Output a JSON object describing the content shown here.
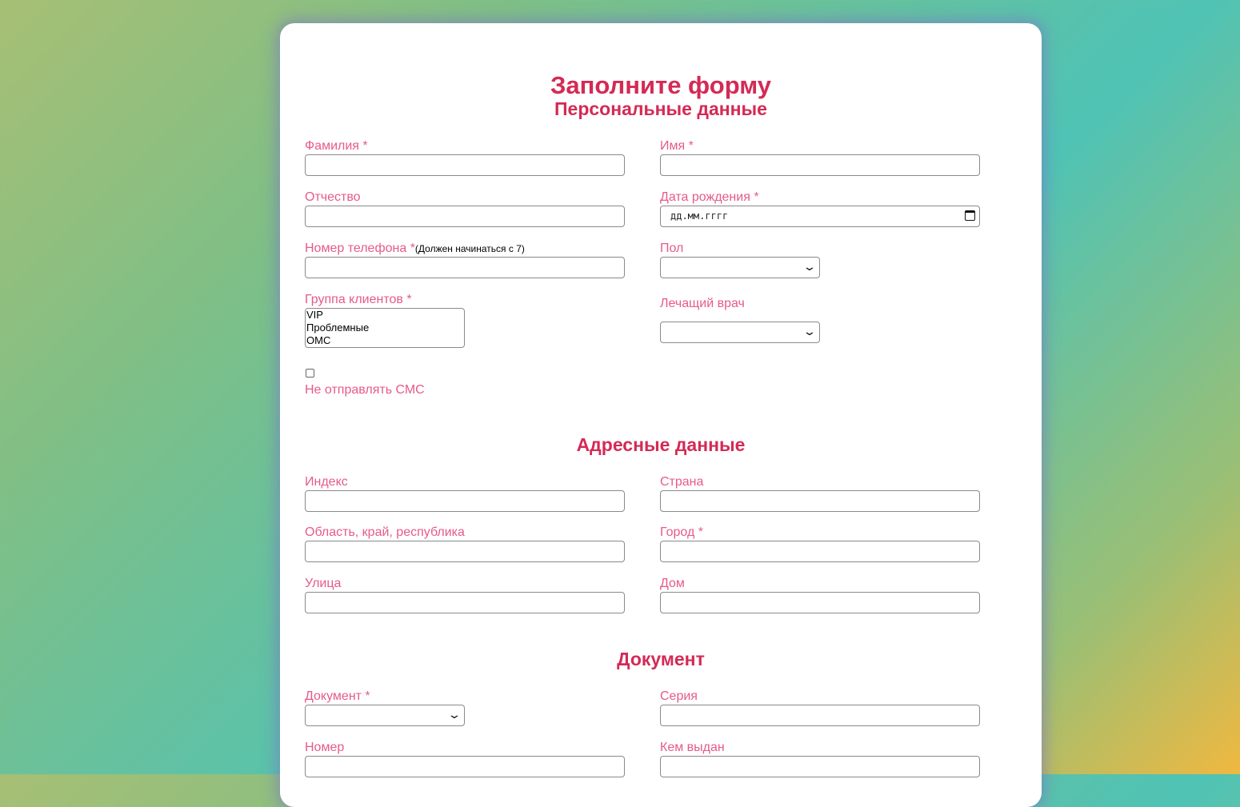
{
  "form": {
    "title": "Заполните форму",
    "sections": {
      "personal": "Персональные данные",
      "address": "Адресные данные",
      "document": "Документ"
    },
    "labels": {
      "last_name": "Фамилия *",
      "first_name": "Имя *",
      "middle_name": "Отчество",
      "birth_date": "Дата рождения *",
      "phone": "Номер телефона *",
      "phone_note": "(Должен начинаться с 7)",
      "gender": "Пол",
      "client_group": "Группа клиентов *",
      "doctor": "Лечащий врач",
      "no_sms": "Не отправлять СМС",
      "index": "Индекс",
      "country": "Страна",
      "region": "Область, край, республика",
      "city": "Город *",
      "street": "Улица",
      "house": "Дом",
      "document": "Документ *",
      "series": "Серия",
      "number": "Номер",
      "issued_by": "Кем выдан"
    },
    "birth_date_placeholder": "дд.мм.гггг",
    "client_group_options": [
      "VIP",
      "Проблемные",
      "ОМС"
    ],
    "no_sms_checked": false
  }
}
